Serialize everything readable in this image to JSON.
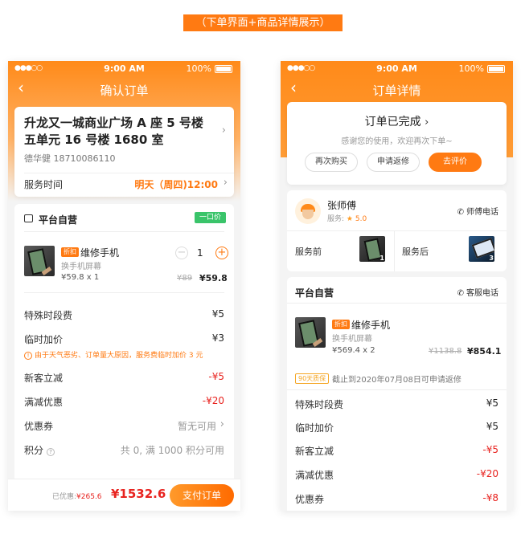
{
  "banner": "（下单界面+商品详情展示）",
  "statusbar": {
    "signal": "●●●○○",
    "wifi": "◠",
    "time": "9:00 AM",
    "battery_pct": "100%"
  },
  "left": {
    "nav_title": "确认订单",
    "address": "升龙又一城商业广场 A 座 5 号楼五单元 16 号楼 1680 室",
    "contact": "德华健   18710086110",
    "service_time_label": "服务时间",
    "service_time_value": "明天（周四)12:00",
    "shop_name": "平台自营",
    "price_tag": "一口价",
    "item": {
      "tag": "折扣",
      "name": "维修手机",
      "sub": "换手机屏幕",
      "unit": "¥59.8 x 1",
      "old": "¥89",
      "total": "¥59.8",
      "qty": "1",
      "minus": "−",
      "plus": "+"
    },
    "fees": [
      {
        "label": "特殊时段费",
        "value": "¥5",
        "style": "normal"
      },
      {
        "label": "临时加价",
        "value": "¥3",
        "style": "normal"
      },
      {
        "label": "新客立减",
        "value": "-¥5",
        "style": "red"
      },
      {
        "label": "满减优惠",
        "value": "-¥20",
        "style": "red"
      },
      {
        "label": "优惠券",
        "value": "暂无可用",
        "style": "grey"
      },
      {
        "label": "积分",
        "value": "共 0, 满 1000 积分可用",
        "style": "grey"
      }
    ],
    "notice": "由于天气恶劣、订单量大原因，服务费临时加价 3 元",
    "saved_label": "已优惠:",
    "saved_amount": "¥265.6",
    "total": "¥1532.6",
    "pay_button": "支付订单"
  },
  "right": {
    "nav_title": "订单详情",
    "status_title": "订单已完成",
    "status_sub": "感谢您的使用，欢迎再次下单~",
    "buttons": [
      "再次购买",
      "申请返修",
      "去评价"
    ],
    "master_name": "张师傅",
    "master_score_label": "服务:",
    "master_score": "5.0",
    "master_call": "师傅电话",
    "before_label": "服务前",
    "before_count": "1",
    "after_label": "服务后",
    "after_count": "3",
    "shop_name": "平台自营",
    "service_call": "客服电话",
    "item": {
      "tag": "折扣",
      "name": "维修手机",
      "sub": "换手机屏幕",
      "unit": "¥569.4 x 2",
      "old": "¥1138.8",
      "total": "¥854.1"
    },
    "guarantee_tag": "90天质保",
    "guarantee_text": "截止到2020年07月08日可申请返修",
    "fees": [
      {
        "label": "特殊时段费",
        "value": "¥5",
        "style": "normal"
      },
      {
        "label": "临时加价",
        "value": "¥5",
        "style": "normal"
      },
      {
        "label": "新客立减",
        "value": "-¥5",
        "style": "red"
      },
      {
        "label": "满减优惠",
        "value": "-¥20",
        "style": "red"
      },
      {
        "label": "优惠券",
        "value": "-¥8",
        "style": "red"
      }
    ]
  },
  "colors": {
    "accent": "#ff7a12",
    "red": "#e8231f",
    "green_tag": "#3ac46a"
  }
}
